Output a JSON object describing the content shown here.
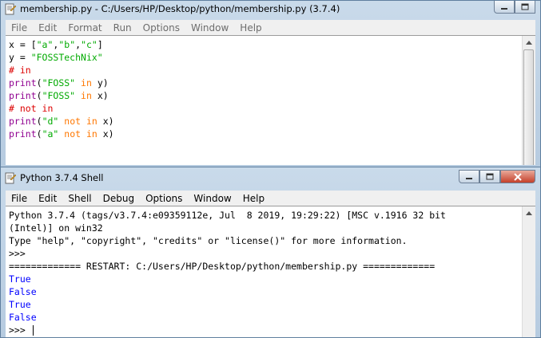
{
  "colors": {
    "keyword": "#ff7700",
    "builtin": "#900090",
    "string": "#00aa00",
    "comment": "#dd0000",
    "default": "#000000",
    "output": "#0000ff"
  },
  "editor": {
    "title": "membership.py - C:/Users/HP/Desktop/python/membership.py (3.7.4)",
    "menu": [
      "File",
      "Edit",
      "Format",
      "Run",
      "Options",
      "Window",
      "Help"
    ],
    "lines": [
      [
        {
          "t": "x = [",
          "c": "default"
        },
        {
          "t": "\"a\"",
          "c": "string"
        },
        {
          "t": ",",
          "c": "default"
        },
        {
          "t": "\"b\"",
          "c": "string"
        },
        {
          "t": ",",
          "c": "default"
        },
        {
          "t": "\"c\"",
          "c": "string"
        },
        {
          "t": "]",
          "c": "default"
        }
      ],
      [
        {
          "t": "y = ",
          "c": "default"
        },
        {
          "t": "\"FOSSTechNix\"",
          "c": "string"
        }
      ],
      [
        {
          "t": "# in",
          "c": "comment"
        }
      ],
      [
        {
          "t": "print",
          "c": "builtin"
        },
        {
          "t": "(",
          "c": "default"
        },
        {
          "t": "\"FOSS\"",
          "c": "string"
        },
        {
          "t": " in ",
          "c": "keyword"
        },
        {
          "t": "y)",
          "c": "default"
        }
      ],
      [
        {
          "t": "print",
          "c": "builtin"
        },
        {
          "t": "(",
          "c": "default"
        },
        {
          "t": "\"FOSS\"",
          "c": "string"
        },
        {
          "t": " in ",
          "c": "keyword"
        },
        {
          "t": "x)",
          "c": "default"
        }
      ],
      [
        {
          "t": "# not in",
          "c": "comment"
        }
      ],
      [
        {
          "t": "print",
          "c": "builtin"
        },
        {
          "t": "(",
          "c": "default"
        },
        {
          "t": "\"d\"",
          "c": "string"
        },
        {
          "t": " not in ",
          "c": "keyword"
        },
        {
          "t": "x)",
          "c": "default"
        }
      ],
      [
        {
          "t": "print",
          "c": "builtin"
        },
        {
          "t": "(",
          "c": "default"
        },
        {
          "t": "\"a\"",
          "c": "string"
        },
        {
          "t": " not in ",
          "c": "keyword"
        },
        {
          "t": "x)",
          "c": "default"
        }
      ]
    ]
  },
  "shell": {
    "title": "Python 3.7.4 Shell",
    "menu": [
      "File",
      "Edit",
      "Shell",
      "Debug",
      "Options",
      "Window",
      "Help"
    ],
    "lines": [
      [
        {
          "t": "Python 3.7.4 (tags/v3.7.4:e09359112e, Jul  8 2019, 19:29:22) [MSC v.1916 32 bit",
          "c": "default"
        }
      ],
      [
        {
          "t": "(Intel)] on win32",
          "c": "default"
        }
      ],
      [
        {
          "t": "Type \"help\", \"copyright\", \"credits\" or \"license()\" for more information.",
          "c": "default"
        }
      ],
      [
        {
          "t": ">>> ",
          "c": "default"
        }
      ],
      [
        {
          "t": "============= RESTART: C:/Users/HP/Desktop/python/membership.py =============",
          "c": "default"
        }
      ],
      [
        {
          "t": "True",
          "c": "output"
        }
      ],
      [
        {
          "t": "False",
          "c": "output"
        }
      ],
      [
        {
          "t": "True",
          "c": "output"
        }
      ],
      [
        {
          "t": "False",
          "c": "output"
        }
      ],
      [
        {
          "t": ">>> ",
          "c": "default",
          "cursor": true
        }
      ]
    ]
  }
}
